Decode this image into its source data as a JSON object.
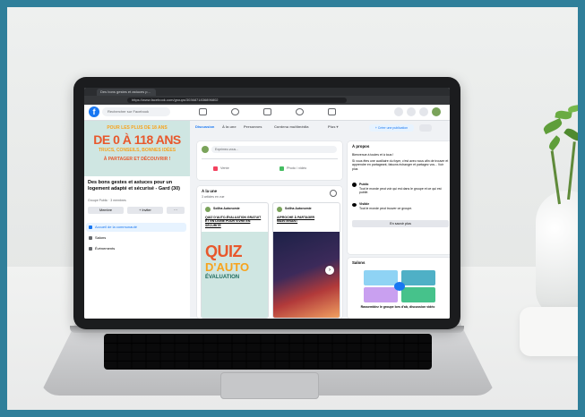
{
  "browser": {
    "tab_title": "Des bons gestes et astuces p...",
    "url": "https://www.facebook.com/groups/3036871836896802"
  },
  "facebook": {
    "search_placeholder": "Rechercher sur Facebook",
    "cover": {
      "line1": "POUR LES PLUS DE 18 ANS",
      "line2": "DE 0 À 118 ANS",
      "line3": "TRUCS, CONSEILS, BONNES IDÉES",
      "line4": "À PARTAGER ET DÉCOUVRIR !"
    },
    "group_name": "Des bons gestes et astuces pour un logement adapté et sécurisé - Gard (30)",
    "group_meta": "Groupe Public · 3 membres",
    "joined_button": "Membre",
    "invite_button": "+ Inviter",
    "left_nav": [
      {
        "label": "Accueil de la communauté"
      },
      {
        "label": "Salons"
      },
      {
        "label": "Événements"
      }
    ],
    "tabs": [
      "Discussion",
      "À la une",
      "Personnes",
      "Contenu multimédia",
      "Plus ▾"
    ],
    "invite_tab_button": "+ Créer une publication",
    "composer": {
      "placeholder": "Exprimez-vous...",
      "action1": "Vente",
      "action2": "Photo / vidéo"
    },
    "featured": {
      "title": "À la une",
      "subtitle": "3 articles en vue",
      "posts": [
        {
          "author": "Soliha Autonomie",
          "caption": "QUIZ D'AUTO-ÉVALUATION GRATUIT ET EN LIGNE POUR VIVRE EN SÉCURITÉ",
          "image_text1": "QUIZ",
          "image_text2": "D'AUTO",
          "image_text3": "ÉVALUATION"
        },
        {
          "author": "Soliha Autonomie",
          "caption": "AIPROCHE À PARTAGER MAINTENANT"
        }
      ]
    },
    "about": {
      "title": "À propos",
      "welcome": "Bienvenue à toutes et à tous !",
      "desc": "Si vous êtes une auxiliaire du foyer, c'est avec nous afin de trouver et apprendre en partageant, faisons échanger et partagez vos... Voir plus",
      "public_title": "Public",
      "public_desc": "Tout le monde peut voir qui est dans le groupe et ce qui est publié.",
      "visible_title": "Visible",
      "visible_desc": "Tout le monde peut trouver ce groupe.",
      "more_button": "En savoir plus"
    },
    "photos": {
      "title": "Salons",
      "caption": "Rassemblez le groupe lors d'ab, discussion vidéo"
    }
  }
}
